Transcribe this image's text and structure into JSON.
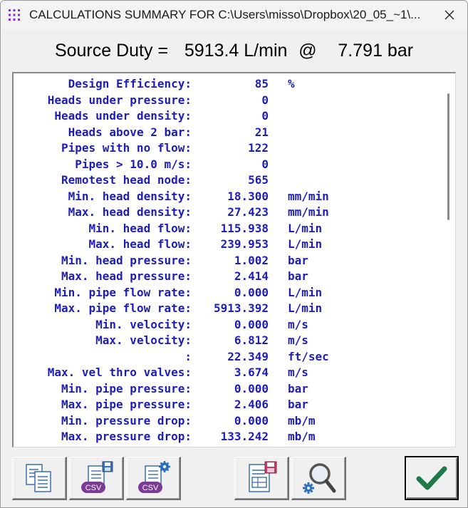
{
  "window": {
    "title": "CALCULATIONS SUMMARY FOR C:\\Users\\misso\\Dropbox\\20_05_~1\\..."
  },
  "header": {
    "source_duty_label": "Source Duty =",
    "flow_value": "5913.4 L/min",
    "at_symbol": "@",
    "pressure_value": "7.791 bar"
  },
  "summary_rows": [
    {
      "label": "Design Efficiency:",
      "value": "85",
      "unit": "%"
    },
    {
      "label": "Heads under pressure:",
      "value": "0",
      "unit": ""
    },
    {
      "label": "Heads under density:",
      "value": "0",
      "unit": ""
    },
    {
      "label": "Heads above 2 bar:",
      "value": "21",
      "unit": ""
    },
    {
      "label": "Pipes with no flow:",
      "value": "122",
      "unit": ""
    },
    {
      "label": "Pipes > 10.0 m/s:",
      "value": "0",
      "unit": ""
    },
    {
      "label": "Remotest head node:",
      "value": "565",
      "unit": ""
    },
    {
      "label": "Min. head density:",
      "value": "18.300",
      "unit": "mm/min"
    },
    {
      "label": "Max. head density:",
      "value": "27.423",
      "unit": "mm/min"
    },
    {
      "label": "Min. head flow:",
      "value": "115.938",
      "unit": "L/min"
    },
    {
      "label": "Max. head flow:",
      "value": "239.953",
      "unit": "L/min"
    },
    {
      "label": "Min. head pressure:",
      "value": "1.002",
      "unit": "bar"
    },
    {
      "label": "Max. head pressure:",
      "value": "2.414",
      "unit": "bar"
    },
    {
      "label": "Min. pipe flow rate:",
      "value": "0.000",
      "unit": "L/min"
    },
    {
      "label": "Max. pipe flow rate:",
      "value": "5913.392",
      "unit": "L/min"
    },
    {
      "label": "Min. velocity:",
      "value": "0.000",
      "unit": "m/s"
    },
    {
      "label": "Max. velocity:",
      "value": "6.812",
      "unit": "m/s"
    },
    {
      "label": ":",
      "value": "22.349",
      "unit": "ft/sec"
    },
    {
      "label": "Max. vel thro valves:",
      "value": "3.674",
      "unit": "m/s"
    },
    {
      "label": "Min. pipe pressure:",
      "value": "0.000",
      "unit": "bar"
    },
    {
      "label": "Max. pipe pressure:",
      "value": "2.406",
      "unit": "bar"
    },
    {
      "label": "Min. pressure drop:",
      "value": "0.000",
      "unit": "mb/m"
    },
    {
      "label": "Max. pressure drop:",
      "value": "133.242",
      "unit": "mb/m"
    }
  ],
  "toolbar": {
    "csv_label_1": "CSV",
    "csv_label_2": "CSV"
  },
  "icons": {
    "app": "app-grid-icon",
    "close": "close-icon",
    "copy": "copy-pages-icon",
    "save_csv": "save-csv-icon",
    "csv_settings": "csv-settings-icon",
    "save_report": "save-report-icon",
    "search_settings": "search-settings-icon",
    "ok": "checkmark-icon"
  },
  "colors": {
    "text_blue": "#1d1dba",
    "ok_green": "#1f7a4a",
    "csv_purple": "#7b3a93"
  }
}
